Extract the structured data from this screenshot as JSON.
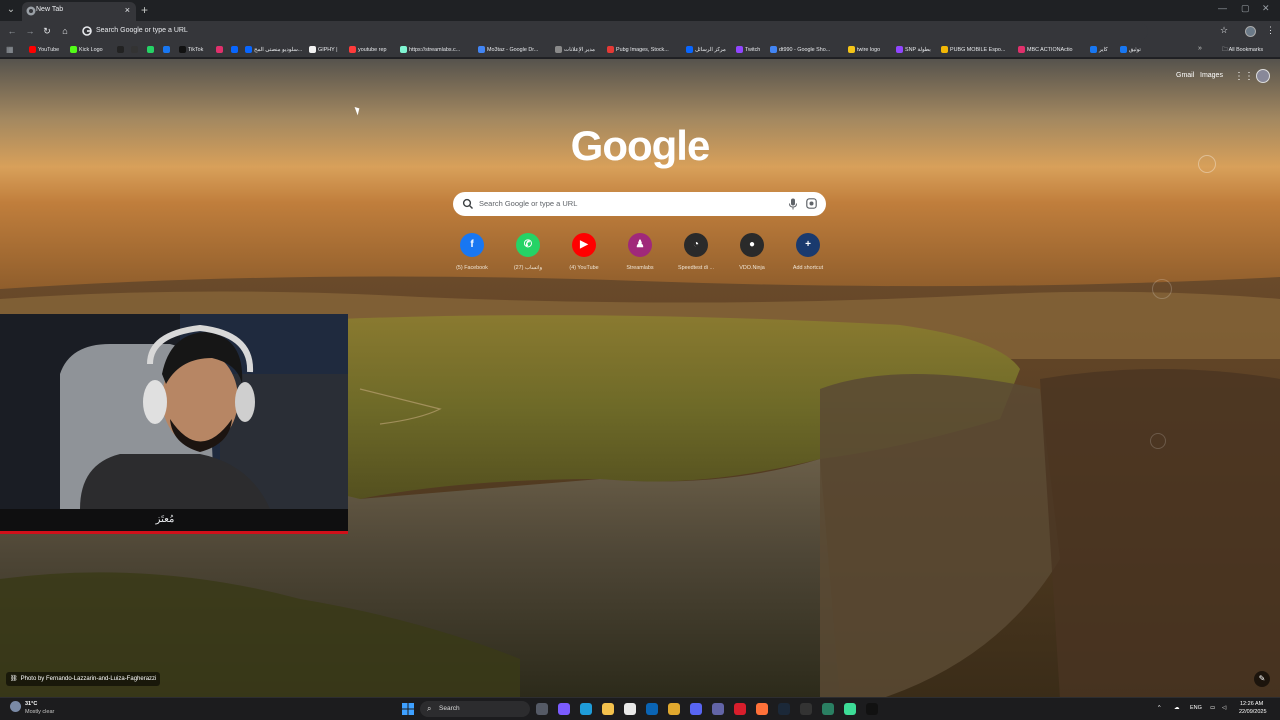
{
  "browser": {
    "tab_title": "New Tab",
    "tab_close": "×",
    "new_tab": "+",
    "omnibox_text": "Search Google or type a URL",
    "minimize": "—",
    "maximize": "▢",
    "close": "✕"
  },
  "bookmarks": [
    {
      "label": "YouTube",
      "color": "#ff0000"
    },
    {
      "label": "Kick Logo",
      "color": "#53fc18"
    },
    {
      "label": "",
      "color": "#222222"
    },
    {
      "label": "",
      "color": "#333333"
    },
    {
      "label": "",
      "color": "#25d366"
    },
    {
      "label": "",
      "color": "#1877f2"
    },
    {
      "label": "TikTok",
      "color": "#111111"
    },
    {
      "label": "",
      "color": "#e1306c"
    },
    {
      "label": "",
      "color": "#0866ff"
    },
    {
      "label": "سلودیو منصتی المح...",
      "color": "#0866ff"
    },
    {
      "label": "GIPHY |",
      "color": "#f2f2f2"
    },
    {
      "label": "youtube rep",
      "color": "#ff3b3b"
    },
    {
      "label": "https://streamlabs.c...",
      "color": "#80f5d2"
    },
    {
      "label": "Mo3taz - Google Dr...",
      "color": "#4285f4"
    },
    {
      "label": "مدير الإعلانات",
      "color": "#8a8a8a"
    },
    {
      "label": "Pubg Images, Stock...",
      "color": "#e53935"
    },
    {
      "label": "مركز الرسائل",
      "color": "#0866ff"
    },
    {
      "label": "Twitch",
      "color": "#9146ff"
    },
    {
      "label": "dt990 - Google Sho...",
      "color": "#4285f4"
    },
    {
      "label": "twire logo",
      "color": "#f5c518"
    },
    {
      "label": "SNP بطولة",
      "color": "#9146ff"
    },
    {
      "label": "PUBG MOBILE Espo...",
      "color": "#f2b705"
    },
    {
      "label": "MBC ACTIONActio",
      "color": "#e1306c"
    },
    {
      "label": "كاير",
      "color": "#1877f2"
    },
    {
      "label": "توثيق",
      "color": "#1877f2"
    }
  ],
  "bookmarks_more": "»",
  "all_bookmarks": "All Bookmarks",
  "ntp": {
    "gmail": "Gmail",
    "images": "Images",
    "logo": "Google",
    "search_placeholder": "Search Google or type a URL",
    "shortcuts": [
      {
        "label": "(5) Facebook",
        "color": "#1877f2",
        "glyph": "f",
        "icon": "facebook-icon"
      },
      {
        "label": "(27) واتساب",
        "color": "#25d366",
        "glyph": "✆",
        "icon": "whatsapp-icon"
      },
      {
        "label": "(4) YouTube",
        "color": "#ff0000",
        "glyph": "▶",
        "icon": "youtube-icon"
      },
      {
        "label": "Streamlabs",
        "color": "#a0287a",
        "glyph": "♟",
        "icon": "streamlabs-icon"
      },
      {
        "label": "Speedtest di ...",
        "color": "#2a2a2a",
        "glyph": "◔",
        "icon": "speedtest-icon"
      },
      {
        "label": "VDO.Ninja",
        "color": "#2a2a2a",
        "glyph": "●",
        "icon": "vdo-ninja-icon"
      },
      {
        "label": "Add shortcut",
        "color": "#1a3a6e",
        "glyph": "+",
        "icon": "add-icon"
      }
    ],
    "webcam_name": "مُعتَز",
    "photo_credit": "Photo by Fernando-Lazzarin-and-Luiza-Fagherazzi",
    "customize": "✎"
  },
  "taskbar": {
    "temp": "31°C",
    "weather": "Mostly clear",
    "search": "Search",
    "language": "ENG",
    "time": "12:26 AM",
    "date": "22/09/2025",
    "apps": [
      {
        "name": "taskview-icon",
        "color": "#555a66"
      },
      {
        "name": "copilot-icon",
        "color": "#7b5cff"
      },
      {
        "name": "edge-icon",
        "color": "#1f9cd9"
      },
      {
        "name": "file-explorer-icon",
        "color": "#f3c14d"
      },
      {
        "name": "store-icon",
        "color": "#e8e8e8"
      },
      {
        "name": "outlook-icon",
        "color": "#0a64b4"
      },
      {
        "name": "chrome-icon",
        "color": "#e0a82e"
      },
      {
        "name": "discord-icon",
        "color": "#5865f2"
      },
      {
        "name": "teams-icon",
        "color": "#6264a7"
      },
      {
        "name": "opera-icon",
        "color": "#d81e2c"
      },
      {
        "name": "firefox-icon",
        "color": "#ff7139"
      },
      {
        "name": "steam-icon",
        "color": "#1b2838"
      },
      {
        "name": "capcut-icon",
        "color": "#333333"
      },
      {
        "name": "chrome-alt-icon",
        "color": "#2a7f62"
      },
      {
        "name": "obs-icon",
        "color": "#3ddc97"
      },
      {
        "name": "kick-icon",
        "color": "#111111"
      }
    ]
  }
}
